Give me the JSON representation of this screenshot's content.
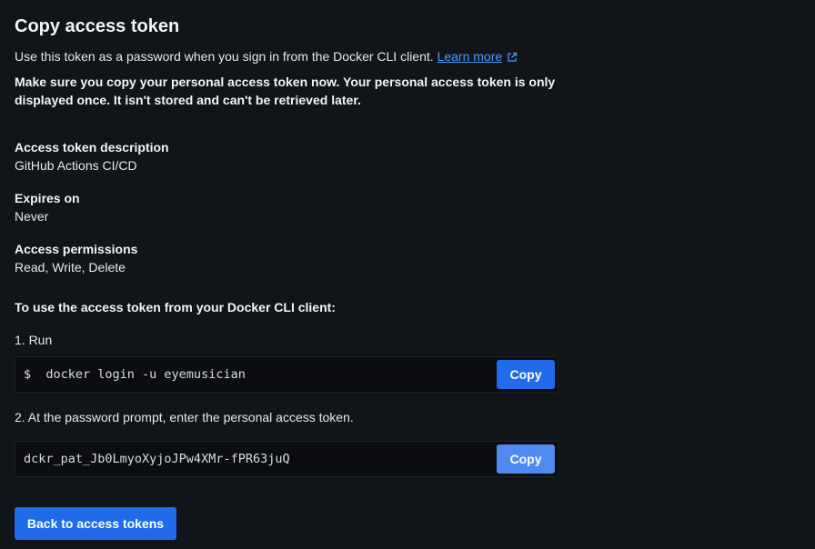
{
  "header": {
    "title": "Copy access token"
  },
  "intro": {
    "text": "Use this token as a password when you sign in from the Docker CLI client. ",
    "link_label": "Learn more"
  },
  "warning": "Make sure you copy your personal access token now. Your personal access token is only displayed once. It isn't stored and can't be retrieved later.",
  "details": {
    "description_label": "Access token description",
    "description_value": "GitHub Actions CI/CD",
    "expires_label": "Expires on",
    "expires_value": "Never",
    "permissions_label": "Access permissions",
    "permissions_value": "Read, Write, Delete"
  },
  "cli": {
    "heading": "To use the access token from your Docker CLI client:",
    "step1_label": "1. Run",
    "login_command": "$  docker login -u eyemusician",
    "step2_label": "2. At the password prompt, enter the personal access token.",
    "token": "dckr_pat_Jb0LmyoXyjoJPw4XMr-fPR63juQ",
    "copy_label": "Copy"
  },
  "footer": {
    "back_label": "Back to access tokens"
  },
  "colors": {
    "background": "#111419",
    "primary": "#1f6bea",
    "link": "#4d9bff"
  }
}
